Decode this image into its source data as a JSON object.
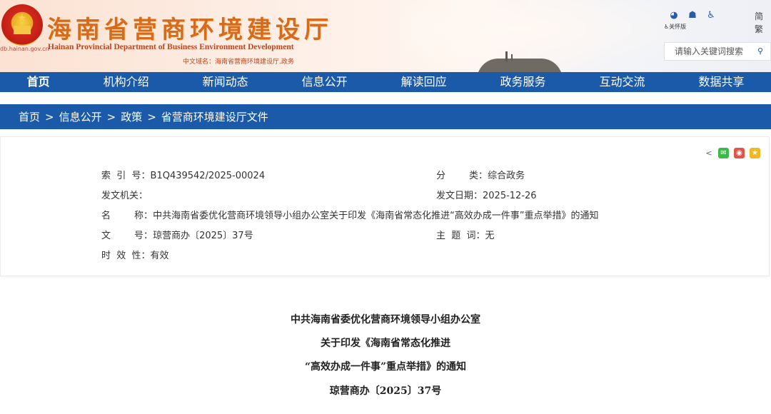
{
  "header": {
    "site_title": "海南省营商环境建设厅",
    "site_title_en": "Hainan Provincial Department of Business Environment Development",
    "domain": "db.hainan.gov.cn",
    "cn_domain": "中文域名：海南省营商环境建设厅.政务",
    "accessibility_label": "关怀版",
    "lang_simplified": "简",
    "lang_traditional": "繁",
    "icons": [
      "weibo-icon",
      "robot-icon",
      "accessibility-icon"
    ]
  },
  "search": {
    "placeholder": "请输入关键词搜索"
  },
  "nav": {
    "items": [
      {
        "label": "首页"
      },
      {
        "label": "机构介绍"
      },
      {
        "label": "新闻动态"
      },
      {
        "label": "信息公开"
      },
      {
        "label": "解读回应"
      },
      {
        "label": "政务服务"
      },
      {
        "label": "互动交流"
      },
      {
        "label": "数据共享"
      }
    ]
  },
  "breadcrumb": {
    "items": [
      "首页",
      "信息公开",
      "政策",
      "省营商环境建设厅文件"
    ],
    "separator": ">"
  },
  "info": {
    "index_label": "索  引  号：",
    "index_value": "B1Q439542/2025-00024",
    "category_label": "分        类：",
    "category_value": "综合政务",
    "issuer_label": "发文机关：",
    "issuer_value": "",
    "date_label": "发文日期：",
    "date_value": "2025-12-26",
    "name_label": "名        称：",
    "name_value": "中共海南省委优化营商环境领导小组办公室关于印发《海南省常态化推进“高效办成一件事”重点举措》的通知",
    "doc_no_label": "文        号：",
    "doc_no_value": "琼营商办〔2025〕37号",
    "keywords_label": "主  题  词：",
    "keywords_value": "无",
    "validity_label": "时  效  性：",
    "validity_value": "有效"
  },
  "document": {
    "title_lines": [
      "中共海南省委优化营商环境领导小组办公室",
      "关于印发《海南省常态化推进",
      "“高效办成一件事”重点举措》的通知",
      "琼营商办〔2025〕37号"
    ]
  }
}
